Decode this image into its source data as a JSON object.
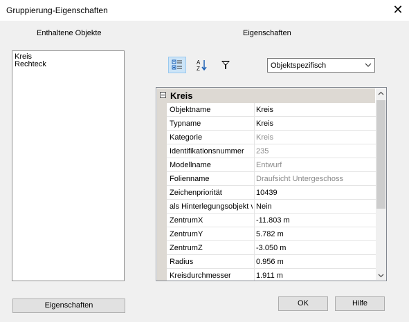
{
  "window": {
    "title": "Gruppierung-Eigenschaften",
    "close_glyph": "✕"
  },
  "left": {
    "heading": "Enthaltene Objekte",
    "items": [
      "Kreis",
      "Rechteck"
    ],
    "properties_button": "Eigenschaften"
  },
  "right": {
    "heading": "Eigenschaften",
    "toolbar": {
      "icons": [
        "categorized-icon",
        "alphabetical-icon",
        "filter-icon"
      ],
      "sort_az_glyph": "A Z"
    },
    "view_select": {
      "value": "Objektspezifisch"
    },
    "grid": {
      "category": "Kreis",
      "rows": [
        {
          "name": "Objektname",
          "value": "Kreis",
          "readonly": false
        },
        {
          "name": "Typname",
          "value": "Kreis",
          "readonly": false
        },
        {
          "name": "Kategorie",
          "value": "Kreis",
          "readonly": true
        },
        {
          "name": "Identifikationsnummer",
          "value": "235",
          "readonly": true
        },
        {
          "name": "Modellname",
          "value": "Entwurf",
          "readonly": true
        },
        {
          "name": "Folienname",
          "value": "Draufsicht Untergeschoss",
          "readonly": true
        },
        {
          "name": "Zeichenpriorität",
          "value": "10439",
          "readonly": false
        },
        {
          "name": "als Hinterlegungsobjekt verwenden",
          "value": "Nein",
          "readonly": false
        },
        {
          "name": "ZentrumX",
          "value": "-11.803 m",
          "readonly": false
        },
        {
          "name": "ZentrumY",
          "value": "5.782 m",
          "readonly": false
        },
        {
          "name": "ZentrumZ",
          "value": "-3.050 m",
          "readonly": false
        },
        {
          "name": "Radius",
          "value": "0.956 m",
          "readonly": false
        },
        {
          "name": "Kreisdurchmesser",
          "value": "1.911 m",
          "readonly": false
        }
      ]
    }
  },
  "buttons": {
    "ok": "OK",
    "help": "Hilfe"
  },
  "colors": {
    "readonly_text": "#8a8a8a",
    "category_band": "#ddd9d3",
    "active_tool": "#cce4f7"
  }
}
